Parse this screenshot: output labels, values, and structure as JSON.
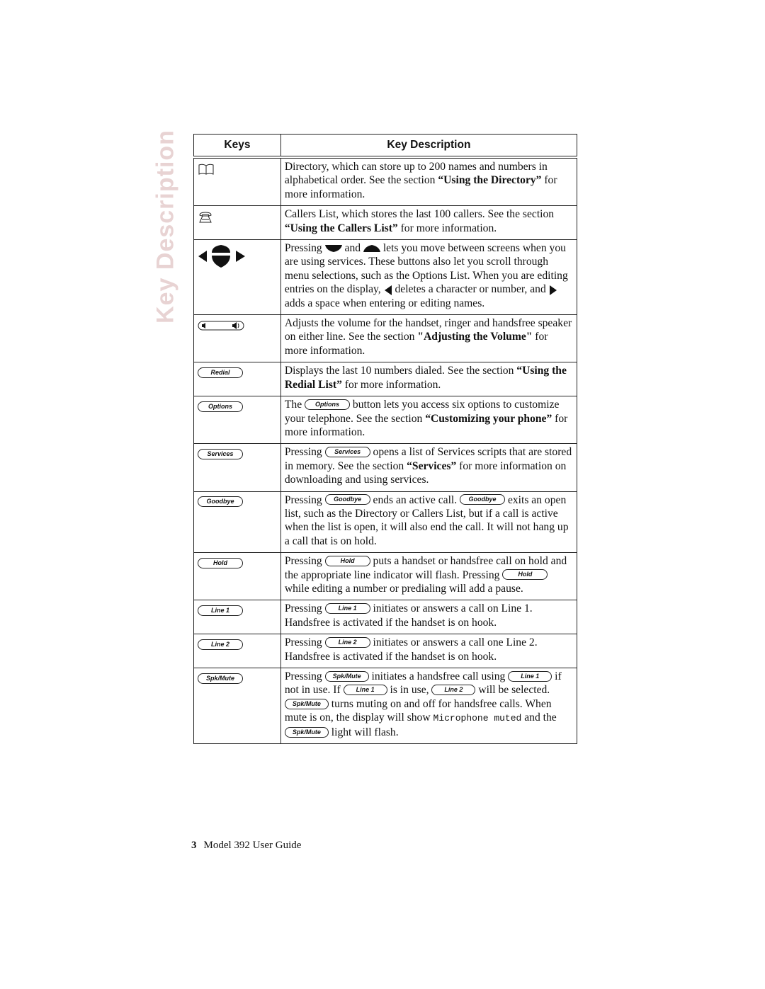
{
  "side_title": "Key Description",
  "table": {
    "headers": {
      "keys": "Keys",
      "description": "Key Description"
    },
    "rows": [
      {
        "key_icon": "directory-book-icon",
        "parts": [
          "Directory, which can store up to 200 names and numbers in alphabetical order. See the section ",
          "“Using the Directory”",
          " for more information."
        ]
      },
      {
        "key_icon": "callers-list-phone-icon",
        "parts": [
          "Callers List, which stores the last 100 callers. See the section ",
          "“Using the Callers List”",
          " for more information."
        ]
      },
      {
        "key_icon": "navigation-arrows-icon",
        "parts": [
          "Pressing ",
          " and ",
          " lets you move between screens when you are using services. These buttons also let you scroll through menu selections, such as the Options List. When you are editing entries on the display, ",
          " deletes a character or number, and ",
          " adds a space when entering or editing names."
        ]
      },
      {
        "key_icon": "volume-control-icon",
        "parts": [
          "Adjusts the volume for the handset, ringer and handsfree speaker on either line. See the section ",
          "\"Adjusting the Volume\"",
          " for more information."
        ]
      },
      {
        "key_label": "Redial",
        "parts": [
          "Displays the last 10 numbers dialed. See the section ",
          "“Using the Redial List”",
          " for more information."
        ]
      },
      {
        "key_label": "Options",
        "parts": [
          "The ",
          " button lets you access six options to customize your telephone. See the section ",
          "“Customizing your phone”",
          " for more information."
        ]
      },
      {
        "key_label": "Services",
        "parts": [
          "Pressing ",
          " opens a list of Services scripts that are stored in memory. See the section ",
          "“Services”",
          " for more information on downloading and using services."
        ]
      },
      {
        "key_label": "Goodbye",
        "parts": [
          "Pressing ",
          " ends an active call. ",
          " exits an open list, such as the Directory or Callers List, but if a call is active when the list is open, it will also end the call. It will not hang up a call that is on hold."
        ]
      },
      {
        "key_label": "Hold",
        "parts": [
          "Pressing ",
          " puts a handset or handsfree call on hold and the appropriate line indicator will flash. Pressing ",
          " while editing a number or predialing will add a pause."
        ]
      },
      {
        "key_label": "Line 1",
        "parts": [
          "Pressing ",
          " initiates or answers a call on Line 1. Handsfree is activated if the handset is on hook."
        ]
      },
      {
        "key_label": "Line 2",
        "parts": [
          "Pressing ",
          " initiates or answers a call one Line 2. Handsfree is activated if the handset is on hook."
        ]
      },
      {
        "key_label": "Spk/Mute",
        "parts": [
          "Pressing ",
          " initiates a handsfree call using ",
          " if not in use. If ",
          " is in use, ",
          " will be selected. ",
          " turns muting on and off for handsfree calls. When mute is on, the display will show ",
          "Microphone muted",
          " and the ",
          " light will flash."
        ]
      }
    ]
  },
  "footer": {
    "page_number": "3",
    "title": "Model 392 User Guide"
  }
}
